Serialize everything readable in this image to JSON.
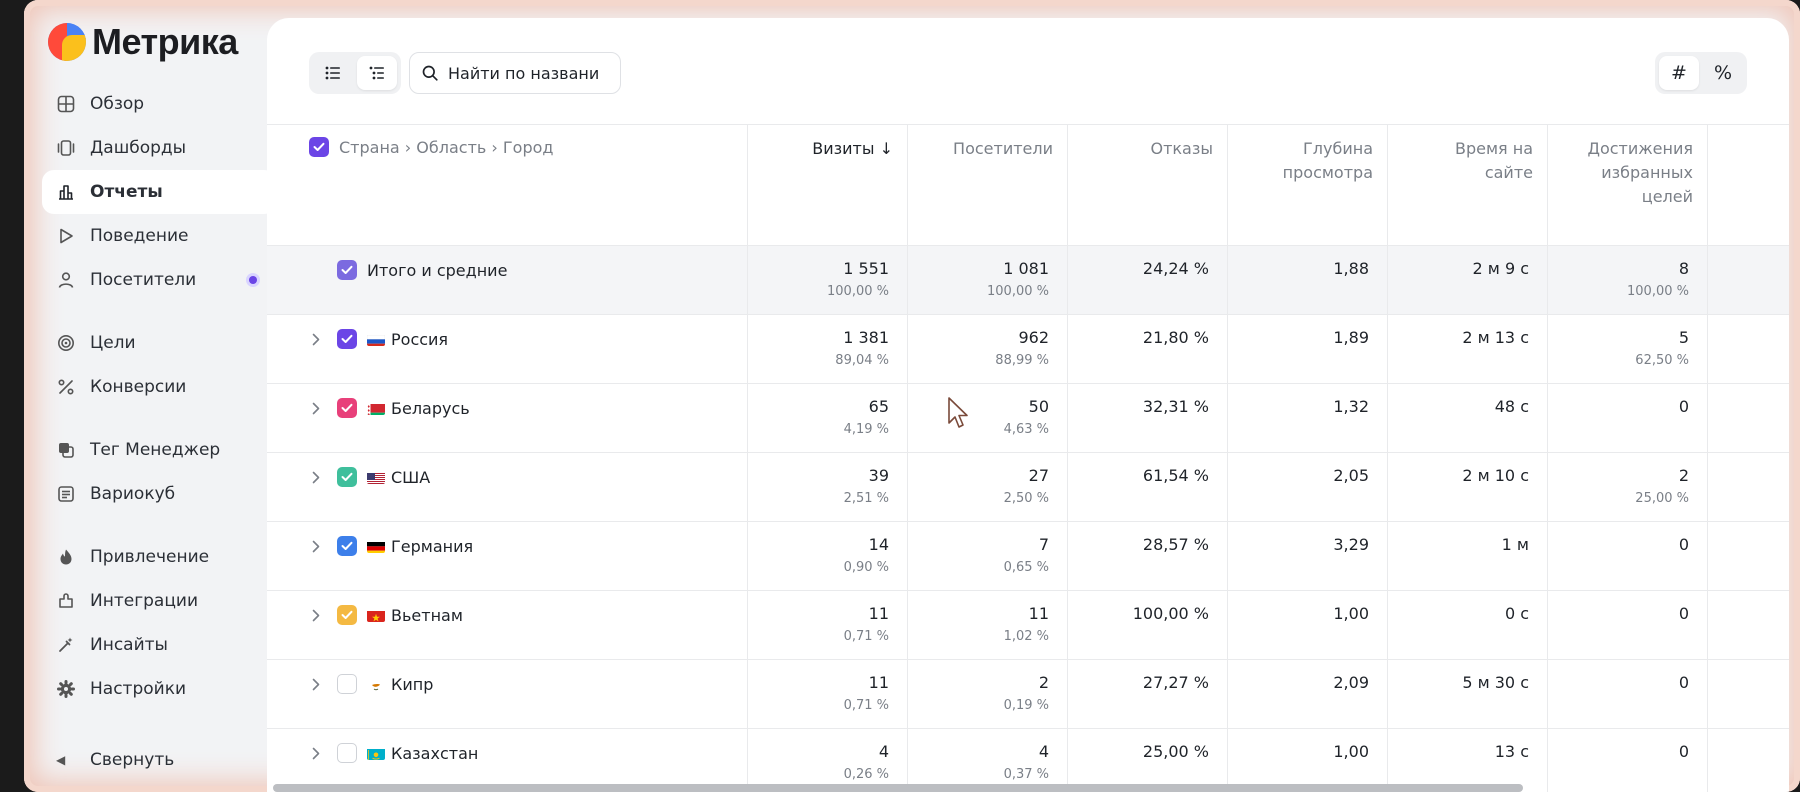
{
  "app": {
    "name": "Метрика"
  },
  "sidebar": {
    "items": [
      {
        "label": "Обзор",
        "icon": "overview-icon"
      },
      {
        "label": "Дашборды",
        "icon": "dashboards-icon"
      },
      {
        "label": "Отчеты",
        "icon": "reports-icon",
        "active": true
      },
      {
        "label": "Поведение",
        "icon": "behavior-icon"
      },
      {
        "label": "Посетители",
        "icon": "visitors-icon",
        "badge": true
      },
      {
        "label": "Цели",
        "icon": "goals-icon"
      },
      {
        "label": "Конверсии",
        "icon": "conversions-icon"
      },
      {
        "label": "Тег Менеджер",
        "icon": "tag-manager-icon"
      },
      {
        "label": "Вариокуб",
        "icon": "variocube-icon"
      },
      {
        "label": "Привлечение",
        "icon": "acquisition-icon"
      },
      {
        "label": "Интеграции",
        "icon": "integrations-icon"
      },
      {
        "label": "Инсайты",
        "icon": "insights-icon"
      },
      {
        "label": "Настройки",
        "icon": "settings-icon"
      }
    ],
    "collapse_label": "Свернуть"
  },
  "toolbar": {
    "search_placeholder": "Найти по названию",
    "unit_absolute": "#",
    "unit_percent": "%"
  },
  "table": {
    "dimension_header": "Страна › Область › Город",
    "columns": [
      {
        "label": "Визиты ↓",
        "sorted": true
      },
      {
        "label": "Посетители"
      },
      {
        "label": "Отказы"
      },
      {
        "label": "Глубина\nпросмотра"
      },
      {
        "label": "Время на\nсайте"
      },
      {
        "label": "Достижения\nизбранных\nцелей"
      }
    ],
    "total": {
      "label": "Итого и средние",
      "visits": "1 551",
      "visits_pct": "100,00 %",
      "visitors": "1 081",
      "visitors_pct": "100,00 %",
      "bounce": "24,24 %",
      "depth": "1,88",
      "time": "2 м 9 с",
      "goals": "8",
      "goals_pct": "100,00 %"
    },
    "rows": [
      {
        "country": "Россия",
        "flag": "ru",
        "check_color": "#6b45e6",
        "visits": "1 381",
        "visits_pct": "89,04 %",
        "visitors": "962",
        "visitors_pct": "88,99 %",
        "bounce": "21,80 %",
        "depth": "1,89",
        "time": "2 м 13 с",
        "goals": "5",
        "goals_pct": "62,50 %"
      },
      {
        "country": "Беларусь",
        "flag": "by",
        "check_color": "#e8407a",
        "visits": "65",
        "visits_pct": "4,19 %",
        "visitors": "50",
        "visitors_pct": "4,63 %",
        "bounce": "32,31 %",
        "depth": "1,32",
        "time": "48 с",
        "goals": "0",
        "goals_pct": ""
      },
      {
        "country": "США",
        "flag": "us",
        "check_color": "#3fbf9c",
        "visits": "39",
        "visits_pct": "2,51 %",
        "visitors": "27",
        "visitors_pct": "2,50 %",
        "bounce": "61,54 %",
        "depth": "2,05",
        "time": "2 м 10 с",
        "goals": "2",
        "goals_pct": "25,00 %"
      },
      {
        "country": "Германия",
        "flag": "de",
        "check_color": "#3d7fea",
        "visits": "14",
        "visits_pct": "0,90 %",
        "visitors": "7",
        "visitors_pct": "0,65 %",
        "bounce": "28,57 %",
        "depth": "3,29",
        "time": "1 м",
        "goals": "0",
        "goals_pct": ""
      },
      {
        "country": "Вьетнам",
        "flag": "vn",
        "check_color": "#f4b942",
        "visits": "11",
        "visits_pct": "0,71 %",
        "visitors": "11",
        "visitors_pct": "1,02 %",
        "bounce": "100,00 %",
        "depth": "1,00",
        "time": "0 с",
        "goals": "0",
        "goals_pct": ""
      },
      {
        "country": "Кипр",
        "flag": "cy",
        "check_color": "",
        "visits": "11",
        "visits_pct": "0,71 %",
        "visitors": "2",
        "visitors_pct": "0,19 %",
        "bounce": "27,27 %",
        "depth": "2,09",
        "time": "5 м 30 с",
        "goals": "0",
        "goals_pct": ""
      },
      {
        "country": "Казахстан",
        "flag": "kz",
        "check_color": "",
        "visits": "4",
        "visits_pct": "0,26 %",
        "visitors": "4",
        "visitors_pct": "0,37 %",
        "bounce": "25,00 %",
        "depth": "1,00",
        "time": "13 с",
        "goals": "0",
        "goals_pct": ""
      }
    ]
  },
  "colors": {
    "accent": "#6b45e6",
    "total_check": "#7b6ae0"
  }
}
